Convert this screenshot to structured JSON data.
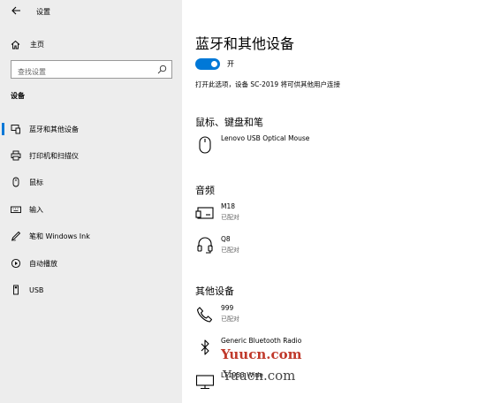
{
  "app": {
    "title": "设置"
  },
  "sidebar": {
    "home_label": "主页",
    "search_placeholder": "查找设置",
    "section_label": "设备",
    "items": [
      {
        "label": "蓝牙和其他设备",
        "icon": "bluetooth-devices-icon",
        "active": true
      },
      {
        "label": "打印机和扫描仪",
        "icon": "printer-icon",
        "active": false
      },
      {
        "label": "鼠标",
        "icon": "mouse-icon",
        "active": false
      },
      {
        "label": "输入",
        "icon": "keyboard-icon",
        "active": false
      },
      {
        "label": "笔和 Windows Ink",
        "icon": "pen-icon",
        "active": false
      },
      {
        "label": "自动播放",
        "icon": "autoplay-icon",
        "active": false
      },
      {
        "label": "USB",
        "icon": "usb-icon",
        "active": false
      }
    ]
  },
  "main": {
    "title": "蓝牙和其他设备",
    "bluetooth_toggle": {
      "state_label": "开",
      "on": true
    },
    "description": "打开此选项，设备 SC-2019 将可供其他用户连接",
    "groups": [
      {
        "title": "鼠标、键盘和笔",
        "devices": [
          {
            "name": "Lenovo USB Optical Mouse",
            "status": "",
            "icon": "mouse-icon"
          }
        ]
      },
      {
        "title": "音频",
        "devices": [
          {
            "name": "M18",
            "status": "已配对",
            "icon": "speaker-icon"
          },
          {
            "name": "Q8",
            "status": "已配对",
            "icon": "headset-icon"
          }
        ]
      },
      {
        "title": "其他设备",
        "devices": [
          {
            "name": "999",
            "status": "已配对",
            "icon": "phone-icon"
          },
          {
            "name": "Generic Bluetooth Radio",
            "status": "",
            "icon": "bluetooth-icon"
          },
          {
            "name": "LT1953 Wide",
            "status": "",
            "icon": "monitor-icon"
          }
        ]
      }
    ]
  },
  "watermark": {
    "line1": "Yuucn.com",
    "line2": "Yuucn.com"
  },
  "colors": {
    "accent": "#0078d7",
    "sidebar_bg": "#ededed",
    "watermark_red": "#c0392b"
  }
}
